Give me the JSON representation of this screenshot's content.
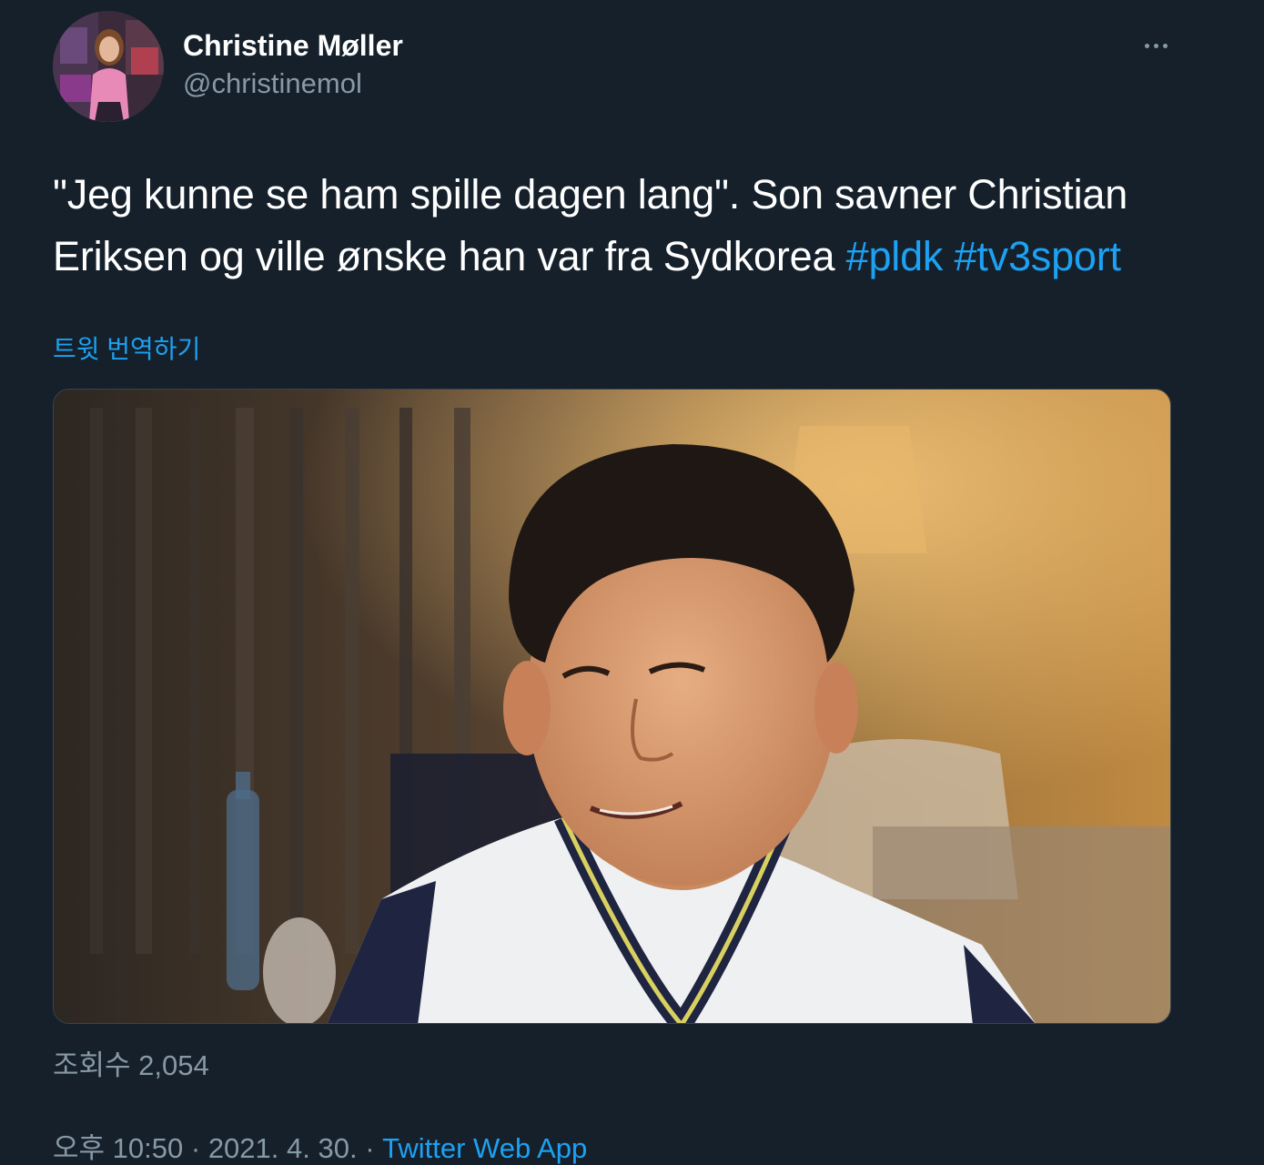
{
  "tweet": {
    "display_name": "Christine Møller",
    "handle": "@christinemol",
    "text_plain": "\"Jeg kunne se ham spille dagen lang\". Son savner Christian Eriksen og ville ønske han var fra Sydkorea",
    "hashtags": [
      "#pldk",
      "#tv3sport"
    ],
    "translate_label": "트윗 번역하기",
    "views_label": "조회수 2,054",
    "time": "오후 10:50",
    "separator": "·",
    "date": "2021. 4. 30.",
    "source": "Twitter Web App"
  },
  "icons": {
    "more": "more-horizontal-icon"
  },
  "colors": {
    "background": "#15202b",
    "text": "#ffffff",
    "secondary": "#8899a6",
    "accent": "#1da1f2"
  }
}
